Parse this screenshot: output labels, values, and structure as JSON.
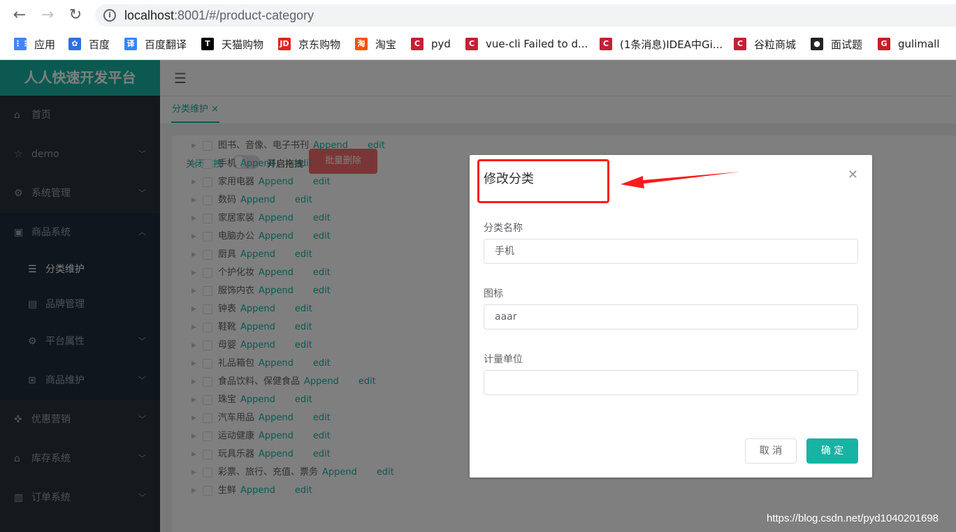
{
  "browser": {
    "url_host": "localhost",
    "url_rest": ":8001/#/product-category",
    "bookmarks": [
      {
        "label": "应用",
        "icon": "apps-grid-icon",
        "color": "#4285f4"
      },
      {
        "label": "百度",
        "icon": "baidu-paw-icon",
        "color": "#2f6fe4"
      },
      {
        "label": "百度翻译",
        "icon": "baidu-translate-icon",
        "color": "#3385ff"
      },
      {
        "label": "天猫购物",
        "icon": "tmall-icon",
        "color": "#000000"
      },
      {
        "label": "京东购物",
        "icon": "jd-icon",
        "color": "#e1251b"
      },
      {
        "label": "淘宝",
        "icon": "taobao-icon",
        "color": "#ff5000"
      },
      {
        "label": "pyd",
        "icon": "csdn-icon",
        "color": "#c32136"
      },
      {
        "label": "vue-cli Failed to d...",
        "icon": "csdn-icon",
        "color": "#c32136"
      },
      {
        "label": "(1条消息)IDEA中Gi...",
        "icon": "csdn-icon",
        "color": "#c32136"
      },
      {
        "label": "谷粒商城",
        "icon": "csdn-icon",
        "color": "#c32136"
      },
      {
        "label": "面试题",
        "icon": "github-icon",
        "color": "#222222"
      },
      {
        "label": "gulimall",
        "icon": "gitee-icon",
        "color": "#c71d23"
      }
    ]
  },
  "sidebar": {
    "brand": "人人快速开发平台",
    "items": [
      {
        "label": "首页",
        "icon": "home-icon"
      },
      {
        "label": "demo",
        "icon": "star-icon"
      },
      {
        "label": "系统管理",
        "icon": "gear-icon"
      },
      {
        "label": "商品系统",
        "icon": "goods-icon"
      },
      {
        "label": "分类维护",
        "icon": "list-icon"
      },
      {
        "label": "品牌管理",
        "icon": "brand-icon"
      },
      {
        "label": "平台属性",
        "icon": "gear-icon"
      },
      {
        "label": "商品维护",
        "icon": "grid-icon"
      },
      {
        "label": "优惠营销",
        "icon": "coupon-icon"
      },
      {
        "label": "库存系统",
        "icon": "home-icon"
      },
      {
        "label": "订单系统",
        "icon": "order-icon"
      }
    ]
  },
  "tabs": [
    {
      "label": "分类维护"
    }
  ],
  "toolbar": {
    "drag_off_label": "关闭拖拽",
    "drag_on_label": "开启拖拽",
    "batch_delete_label": "批量删除"
  },
  "tree": {
    "append_label": "Append",
    "edit_label": "edit",
    "nodes": [
      "图书、音像、电子书刊",
      "手机",
      "家用电器",
      "数码",
      "家居家装",
      "电脑办公",
      "厨具",
      "个护化妆",
      "服饰内衣",
      "钟表",
      "鞋靴",
      "母婴",
      "礼品箱包",
      "食品饮料、保健食品",
      "珠宝",
      "汽车用品",
      "运动健康",
      "玩具乐器",
      "彩票、旅行、充值、票务",
      "生鲜"
    ]
  },
  "dialog": {
    "title": "修改分类",
    "fields": [
      {
        "label": "分类名称",
        "value": "手机"
      },
      {
        "label": "图标",
        "value": "aaar"
      },
      {
        "label": "计量单位",
        "value": ""
      }
    ],
    "cancel_label": "取 消",
    "ok_label": "确 定"
  },
  "watermark": "https://blog.csdn.net/pyd1040201698",
  "colors": {
    "accent": "#17b3a3",
    "danger": "#f56c6c",
    "sidebar": "#263238",
    "annotation": "#ff1a1a"
  }
}
